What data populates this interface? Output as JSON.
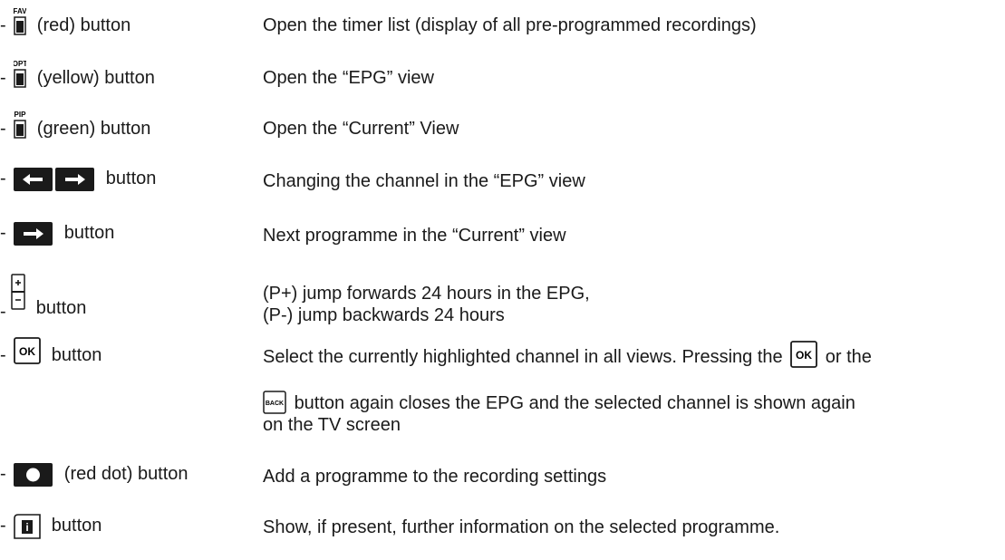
{
  "rows": [
    {
      "key_caption": "FAV",
      "label": "(red) button",
      "icon": "fav-key-icon",
      "desc": "Open the timer list (display of all pre-programmed recordings)"
    },
    {
      "key_caption": "OPT",
      "label": "(yellow) button",
      "icon": "opt-key-icon",
      "desc": "Open the “EPG” view"
    },
    {
      "key_caption": "PIP",
      "label": "(green) button",
      "icon": "pip-key-icon",
      "desc": "Open the “Current” View"
    },
    {
      "label": "button",
      "icon": "rewind-forward-keys-icon",
      "desc": "Changing the channel in the “EPG” view"
    },
    {
      "label": "button",
      "icon": "forward-key-icon",
      "desc": "Next programme in the “Current” view"
    },
    {
      "label": "button",
      "icon": "program-up-down-key-icon",
      "desc1": "(P+) jump forwards 24 hours in the EPG,",
      "desc2": "(P-) jump backwards 24 hours"
    },
    {
      "key_caption": "OK",
      "label": "button",
      "icon": "ok-key-icon",
      "desc_a": "Select the currently highlighted channel in all views. Pressing the",
      "desc_b": "or the",
      "desc_c": "button again closes the EPG and the selected channel is shown again",
      "desc_d": "on the TV screen"
    },
    {
      "label": "(red dot) button",
      "icon": "record-key-icon",
      "desc": "Add a programme to the recording settings"
    },
    {
      "key_caption": "i",
      "label": "button",
      "icon": "info-key-icon",
      "desc": "Show, if present, further information on the selected programme."
    }
  ],
  "back_key_caption": "BACK",
  "dash": "-"
}
